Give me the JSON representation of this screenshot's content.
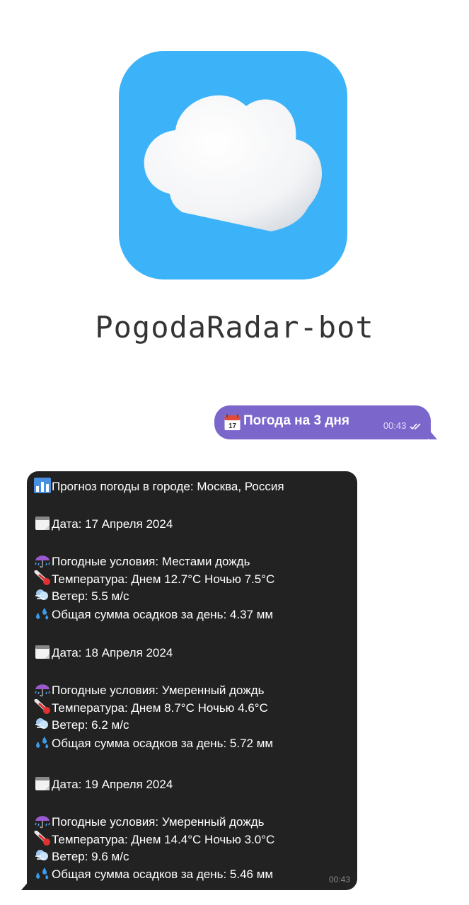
{
  "header": {
    "app_icon": "cloud-icon",
    "icon_bg_color": "#3cb2f8",
    "bot_name": "PogodaRadar-bot"
  },
  "outgoing": {
    "icon": "calendar-icon",
    "text": "Погода на 3 дня",
    "time": "00:43",
    "status_icon": "double-check-icon",
    "bubble_color": "#7b66cc"
  },
  "incoming": {
    "bubble_color": "#222222",
    "time": "00:43",
    "header": {
      "icon": "bar-chart-icon",
      "text": "Прогноз погоды в городе: Москва, Россия"
    },
    "days": [
      {
        "date": "Дата: 17 Апреля 2024",
        "conditions": "Погодные условия: Местами дождь",
        "temperature": "Температура: Днем 12.7°C Ночью 7.5°C",
        "wind": "Ветер: 5.5 м/с",
        "precipitation": "Общая сумма осадков за день: 4.37 мм"
      },
      {
        "date": "Дата: 18 Апреля 2024",
        "conditions": "Погодные условия: Умеренный дождь",
        "temperature": "Температура: Днем 8.7°C Ночью 4.6°C",
        "wind": "Ветер: 6.2 м/с",
        "precipitation": "Общая сумма осадков за день: 5.72 мм"
      },
      {
        "date": "Дата: 19 Апреля 2024",
        "conditions": "Погодные условия: Умеренный дождь",
        "temperature": "Температура: Днем 14.4°C Ночью 3.0°C",
        "wind": "Ветер: 9.6 м/с",
        "precipitation": "Общая сумма осадков за день: 5.46 мм"
      }
    ],
    "line_icons": {
      "date": "calendar-icon",
      "conditions": "umbrella-rain-icon",
      "temperature": "thermometer-icon",
      "wind": "wind-icon",
      "precipitation": "droplets-icon"
    }
  }
}
